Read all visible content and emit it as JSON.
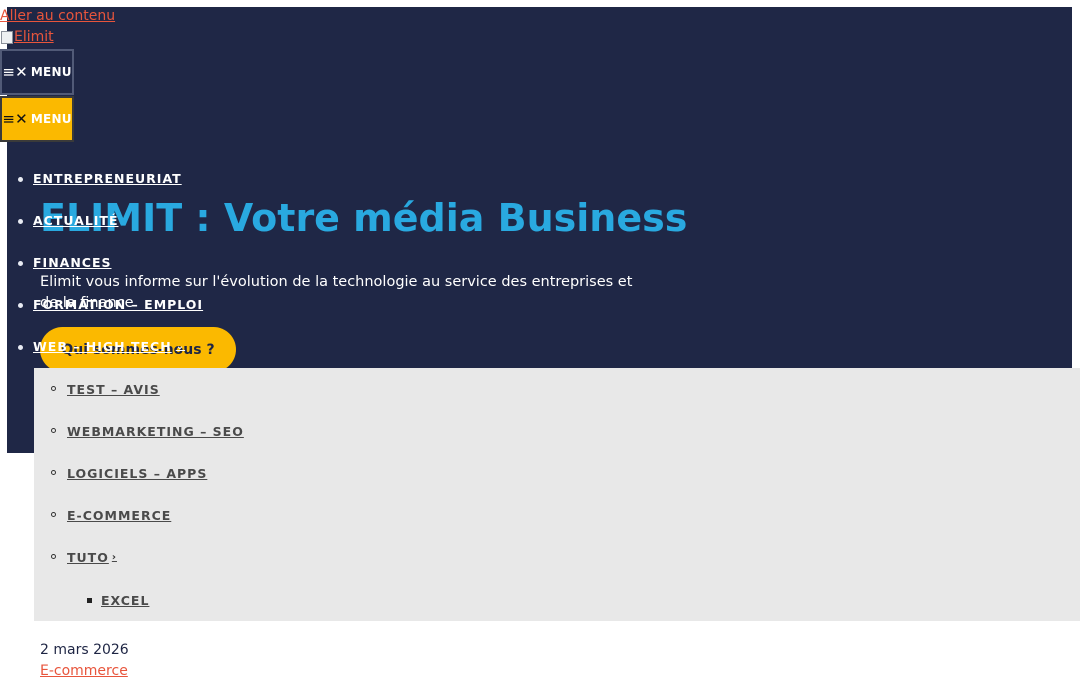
{
  "skip_link": "Aller au contenu",
  "logo_alt": "Elimit",
  "menu_toggle": [
    {
      "label": "MENU",
      "icon": "hamburger-close-icon"
    },
    {
      "label": "MENU",
      "icon": "hamburger-close-icon"
    }
  ],
  "nav": {
    "items": [
      {
        "label": "ENTREPRENEURIAT"
      },
      {
        "label": "ACTUALITÉ"
      },
      {
        "label": "FINANCES"
      },
      {
        "label": "FORMATION – EMPLOI"
      },
      {
        "label": "WEB – HIGH TECH",
        "icon": "chevron-down-icon"
      }
    ],
    "submenu": [
      {
        "label": "TEST – AVIS"
      },
      {
        "label": "WEBMARKETING – SEO"
      },
      {
        "label": "LOGICIELS – APPS"
      },
      {
        "label": "E-COMMERCE"
      },
      {
        "label": "TUTO",
        "icon": "chevron-right-icon"
      }
    ],
    "submenu_level2": [
      {
        "label": "EXCEL"
      }
    ]
  },
  "hero": {
    "title": "ELIMIT : Votre média Business",
    "text": "Elimit vous informe sur l'évolution de la technologie au service des entreprises et de la finance",
    "cta": "Qui sommes-nous ?"
  },
  "post": {
    "date": "2 mars 2026",
    "category": "E-commerce"
  },
  "colors": {
    "hero_background": "#1f2746",
    "accent_yellow": "#fbb900",
    "title_blue": "#29a9e0",
    "link_red": "#e8553c",
    "submenu_background": "#e8e8e8"
  }
}
